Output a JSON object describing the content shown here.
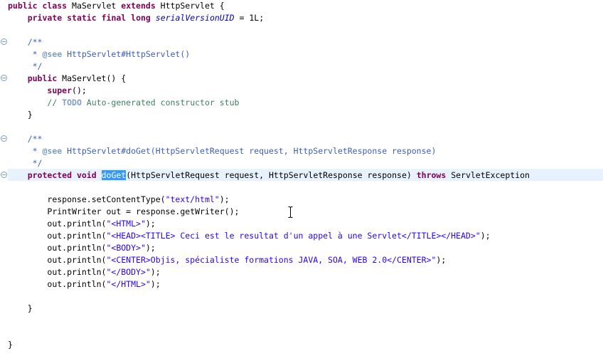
{
  "editor": {
    "lines": {
      "l1": {
        "kw1": "public",
        "sp1": " ",
        "kw2": "class",
        "t1": " MaServlet ",
        "kw3": "extends",
        "t2": " HttpServlet {"
      },
      "l2": {
        "indent": "    ",
        "kw1": "private",
        "sp1": " ",
        "kw2": "static",
        "sp2": " ",
        "kw3": "final",
        "sp3": " ",
        "kw4": "long",
        "sp4": " ",
        "field": "serialVersionUID",
        "t1": " = 1L;"
      },
      "l4": {
        "indent": "    ",
        "t1": "/**"
      },
      "l5": {
        "indent": "     * ",
        "tag": "@see",
        "t1": " HttpServlet#HttpServlet()"
      },
      "l6": {
        "indent": "     ",
        "t1": "*/"
      },
      "l7": {
        "indent": "    ",
        "kw1": "public",
        "t1": " MaServlet() {"
      },
      "l8": {
        "indent": "        ",
        "kw1": "super",
        "t1": "();"
      },
      "l9": {
        "indent": "        ",
        "t1": "// ",
        "todo": "TODO",
        "t2": " Auto-generated constructor stub"
      },
      "l10": {
        "indent": "    ",
        "t1": "}"
      },
      "l12": {
        "indent": "    ",
        "t1": "/**"
      },
      "l13": {
        "indent": "     * ",
        "tag": "@see",
        "t1": " HttpServlet#doGet(HttpServletRequest request, HttpServletResponse response)"
      },
      "l14": {
        "indent": "     ",
        "t1": "*/"
      },
      "l15": {
        "indent": "    ",
        "kw1": "protected",
        "sp1": " ",
        "kw2": "void",
        "sp2": " ",
        "sel": "doGet",
        "t1": "(HttpServletRequest request, HttpServletResponse response) ",
        "kw3": "throws",
        "t2": " ServletException"
      },
      "l17": {
        "indent": "        ",
        "t1": "response.setContentType(",
        "s1": "\"text/html\"",
        "t2": ");"
      },
      "l18": {
        "indent": "        ",
        "t1": "PrintWriter out = response.getWriter();"
      },
      "l19": {
        "indent": "        ",
        "t1": "out.println(",
        "s1": "\"<HTML>\"",
        "t2": ");"
      },
      "l20": {
        "indent": "        ",
        "t1": "out.println(",
        "s1": "\"<HEAD><TITLE> Ceci est le resultat d'un appel à une Servlet</TITLE></HEAD>\"",
        "t2": ");"
      },
      "l21": {
        "indent": "        ",
        "t1": "out.println(",
        "s1": "\"<BODY>\"",
        "t2": ");"
      },
      "l22": {
        "indent": "        ",
        "t1": "out.println(",
        "s1": "\"<CENTER>Objis, spécialiste formations JAVA, SOA, WEB 2.0</CENTER>\"",
        "t2": ");"
      },
      "l23": {
        "indent": "        ",
        "t1": "out.println(",
        "s1": "\"</BODY>\"",
        "t2": ");"
      },
      "l24": {
        "indent": "        ",
        "t1": "out.println(",
        "s1": "\"</HTML>\"",
        "t2": ");"
      },
      "l26": {
        "indent": "    ",
        "t1": "}"
      },
      "l29": {
        "indent": "",
        "t1": "}"
      }
    },
    "fold_icon": "collapse-minus-icon",
    "cursor_icon": "text-ibeam-cursor-icon"
  },
  "colors": {
    "keyword": "#7f0055",
    "string": "#2a00ff",
    "javadoc": "#3f5fbf",
    "line_comment": "#3f7f5f",
    "field": "#0000c0",
    "selection": "#3399ff",
    "current_line": "#e8f2fe"
  }
}
